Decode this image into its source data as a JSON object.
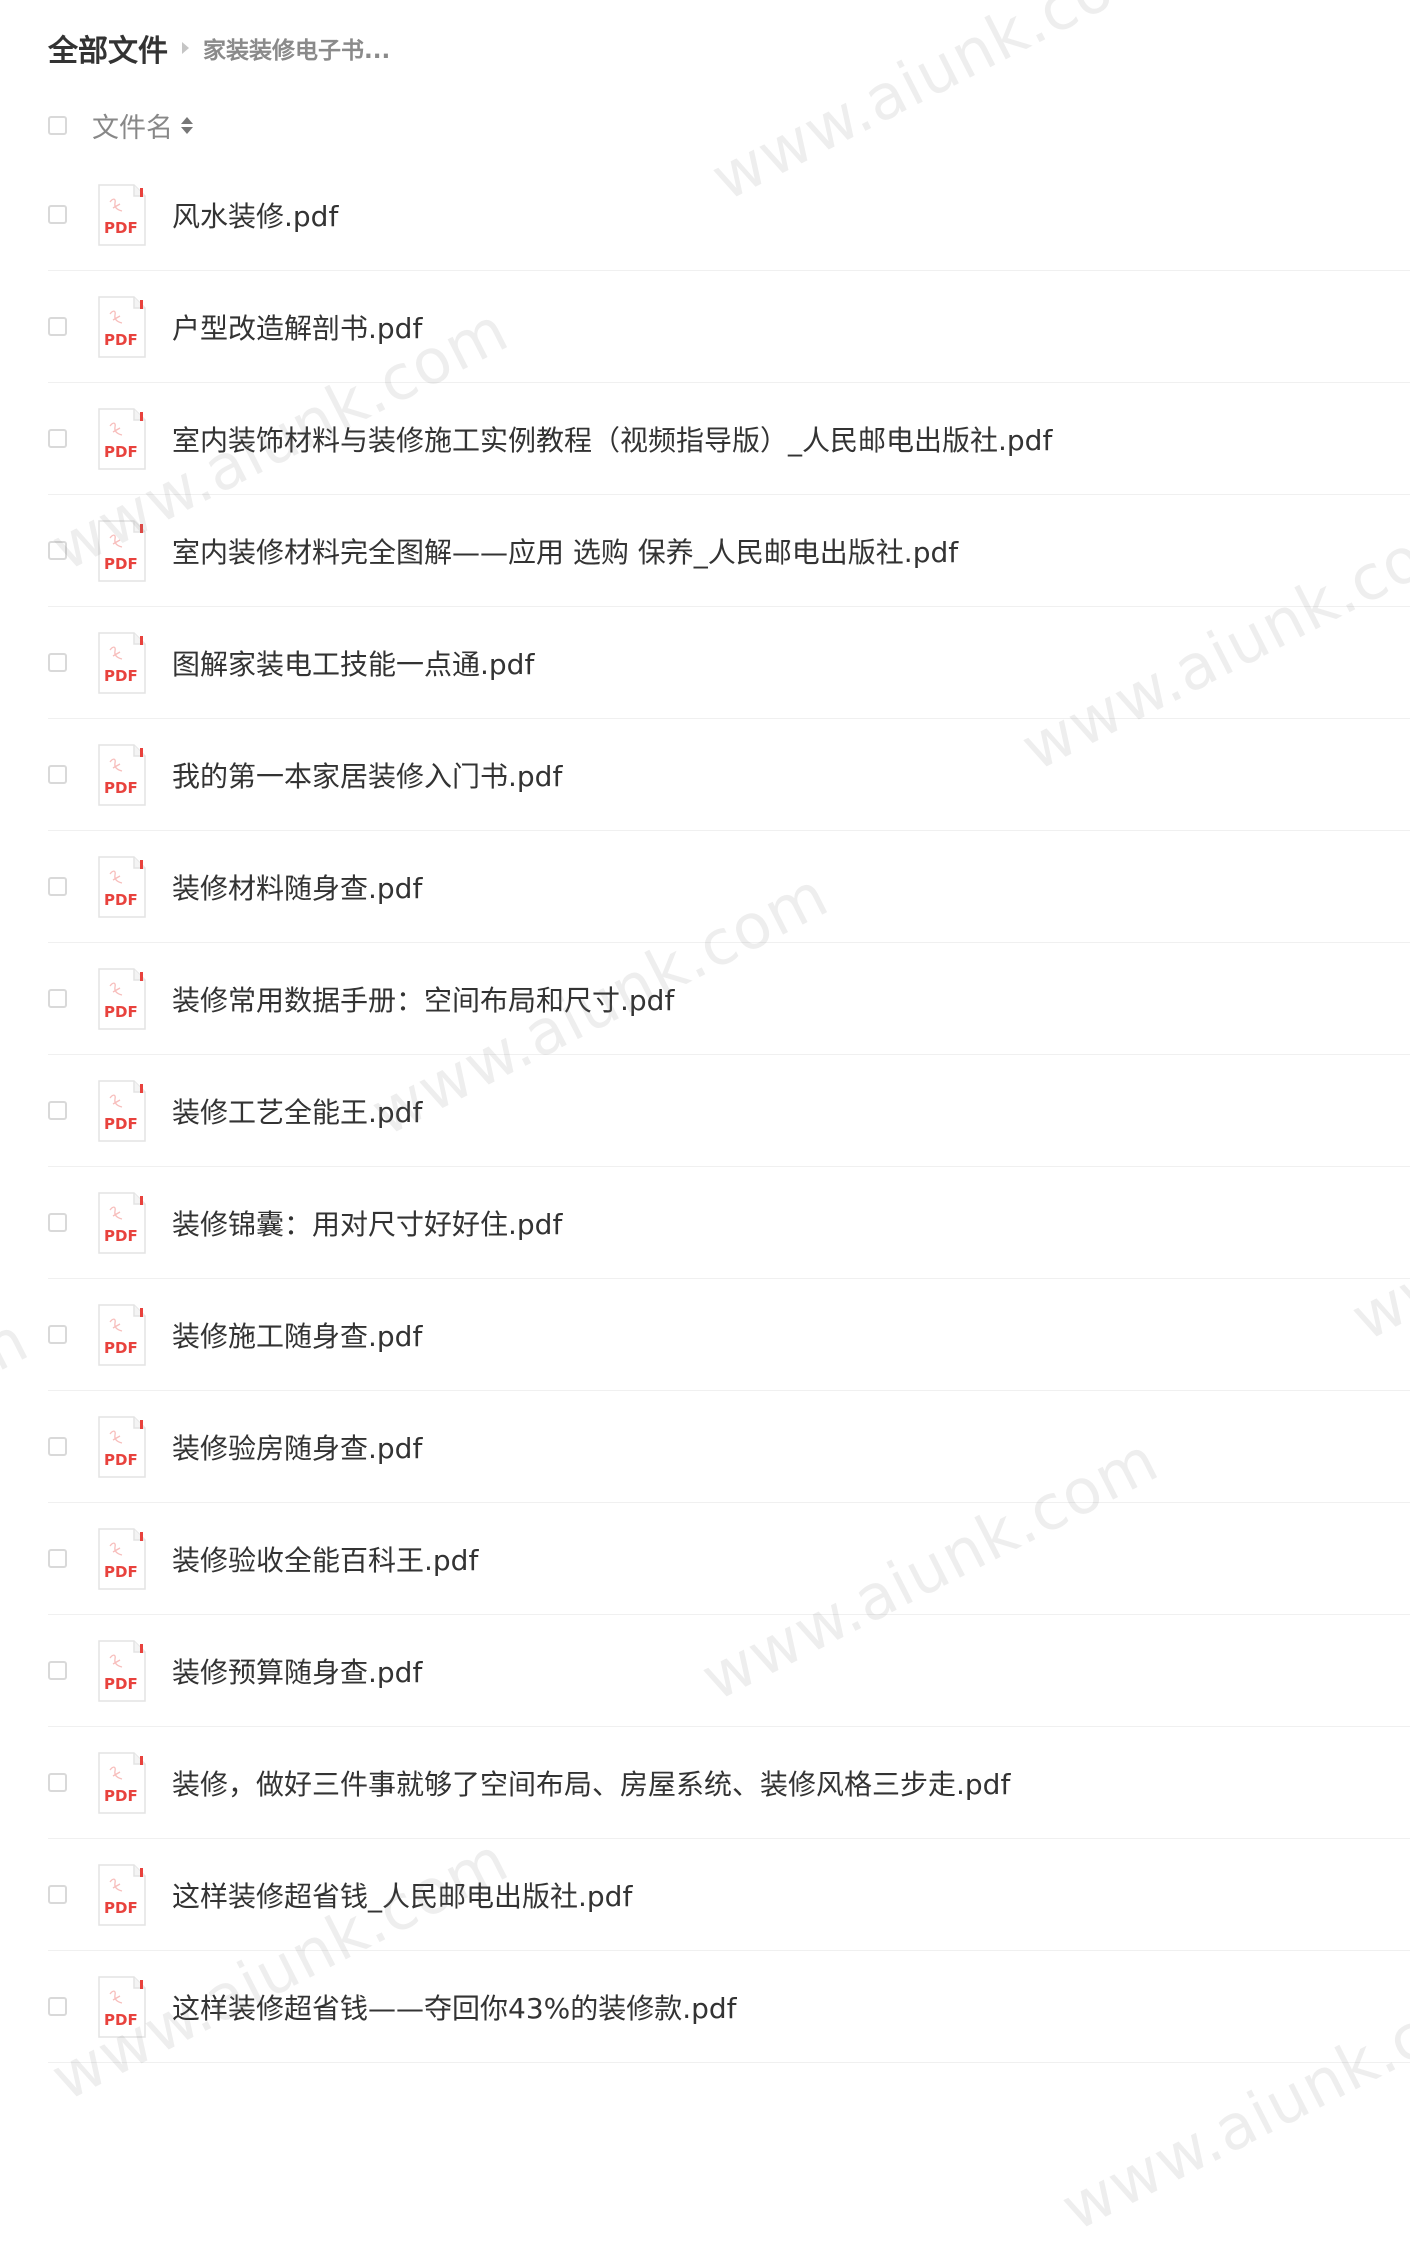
{
  "breadcrumb": {
    "root": "全部文件",
    "current": "家装装修电子书..."
  },
  "list_header": {
    "column_name": "文件名"
  },
  "files": [
    {
      "name": "风水装修.pdf"
    },
    {
      "name": "户型改造解剖书.pdf"
    },
    {
      "name": "室内装饰材料与装修施工实例教程（视频指导版）_人民邮电出版社.pdf"
    },
    {
      "name": "室内装修材料完全图解——应用 选购 保养_人民邮电出版社.pdf"
    },
    {
      "name": "图解家装电工技能一点通.pdf"
    },
    {
      "name": "我的第一本家居装修入门书.pdf"
    },
    {
      "name": "装修材料随身查.pdf"
    },
    {
      "name": "装修常用数据手册：空间布局和尺寸.pdf"
    },
    {
      "name": "装修工艺全能王.pdf"
    },
    {
      "name": "装修锦囊：用对尺寸好好住.pdf"
    },
    {
      "name": "装修施工随身查.pdf"
    },
    {
      "name": "装修验房随身查.pdf"
    },
    {
      "name": "装修验收全能百科王.pdf"
    },
    {
      "name": "装修预算随身查.pdf"
    },
    {
      "name": "装修，做好三件事就够了空间布局、房屋系统、装修风格三步走.pdf"
    },
    {
      "name": "这样装修超省钱_人民邮电出版社.pdf"
    },
    {
      "name": "这样装修超省钱——夺回你43%的装修款.pdf"
    }
  ],
  "file_icon": {
    "label": "PDF",
    "color": "#e8423d"
  },
  "watermark": {
    "text": "www.aiunk.com"
  }
}
